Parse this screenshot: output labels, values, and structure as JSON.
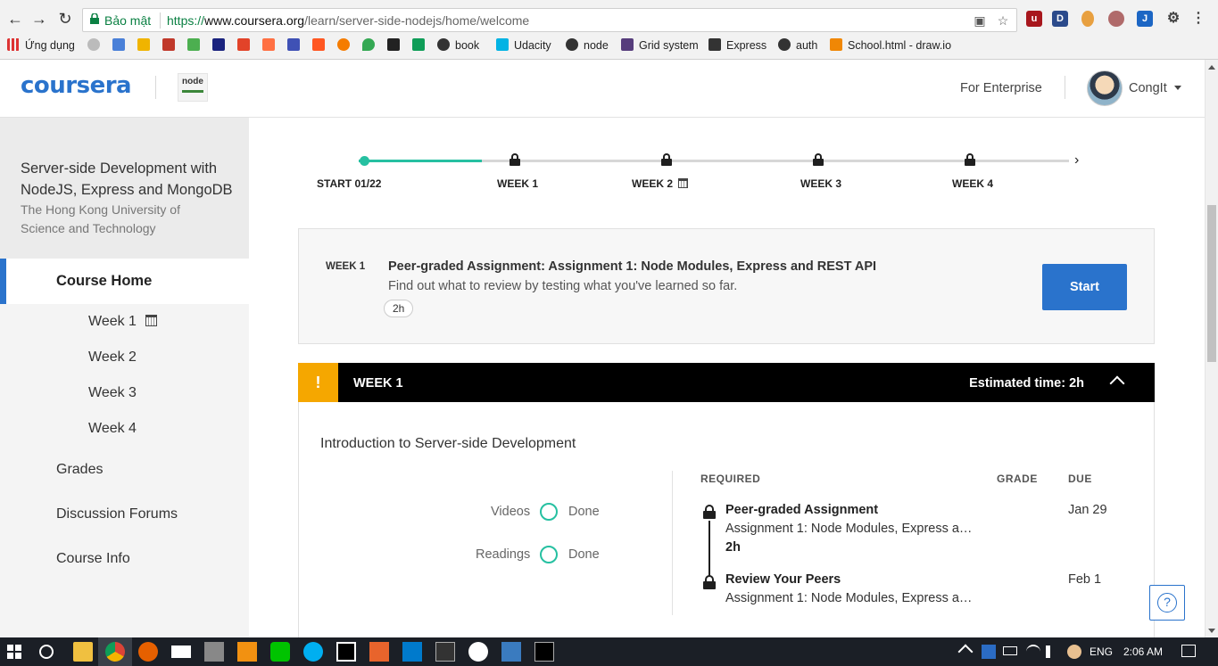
{
  "browser": {
    "secure_label": "Bảo mật",
    "url_scheme": "https://",
    "url_host": "www.coursera.org",
    "url_path": "/learn/server-side-nodejs/home/welcome",
    "bookmarks": [
      "Ứng dụng",
      "book",
      "Udacity",
      "node",
      "Grid system",
      "Express",
      "auth",
      "School.html - draw.io"
    ]
  },
  "header": {
    "logo_text": "coursera",
    "partner_logo_text": "node",
    "enterprise_link": "For Enterprise",
    "username": "CongIt"
  },
  "sidebar": {
    "course_title": "Server-side Development with NodeJS, Express and MongoDB",
    "university": "The Hong Kong University of Science and Technology",
    "home_label": "Course Home",
    "weeks": [
      "Week 1",
      "Week 2",
      "Week 3",
      "Week 4"
    ],
    "items": [
      "Grades",
      "Discussion Forums",
      "Course Info"
    ]
  },
  "timeline": {
    "start_label": "START 01/22",
    "weeks": [
      "WEEK 1",
      "WEEK 2",
      "WEEK 3",
      "WEEK 4"
    ]
  },
  "next_item": {
    "week": "WEEK 1",
    "title": "Peer-graded Assignment: Assignment 1: Node Modules, Express and REST API",
    "description": "Find out what to review by testing what you've learned so far.",
    "duration": "2h",
    "button": "Start"
  },
  "week_section": {
    "warning_glyph": "!",
    "title": "WEEK 1",
    "estimated": "Estimated time: 2h",
    "module_title": "Introduction to Server-side Development",
    "progress": [
      {
        "label": "Videos",
        "status": "Done"
      },
      {
        "label": "Readings",
        "status": "Done"
      }
    ],
    "columns": {
      "required": "REQUIRED",
      "grade": "GRADE",
      "due": "DUE"
    },
    "items": [
      {
        "type": "Peer-graded Assignment",
        "name": "Assignment 1: Node Modules, Express a…",
        "duration": "2h",
        "due": "Jan 29"
      },
      {
        "type": "Review Your Peers",
        "name": "Assignment 1: Node Modules, Express a…",
        "due": "Feb 1"
      }
    ]
  },
  "help_glyph": "?",
  "taskbar": {
    "language": "ENG",
    "time": "2:06 AM"
  },
  "colors": {
    "brand_blue": "#2a73cc",
    "progress_teal": "#26c0a1",
    "warning_orange": "#f5a700"
  }
}
